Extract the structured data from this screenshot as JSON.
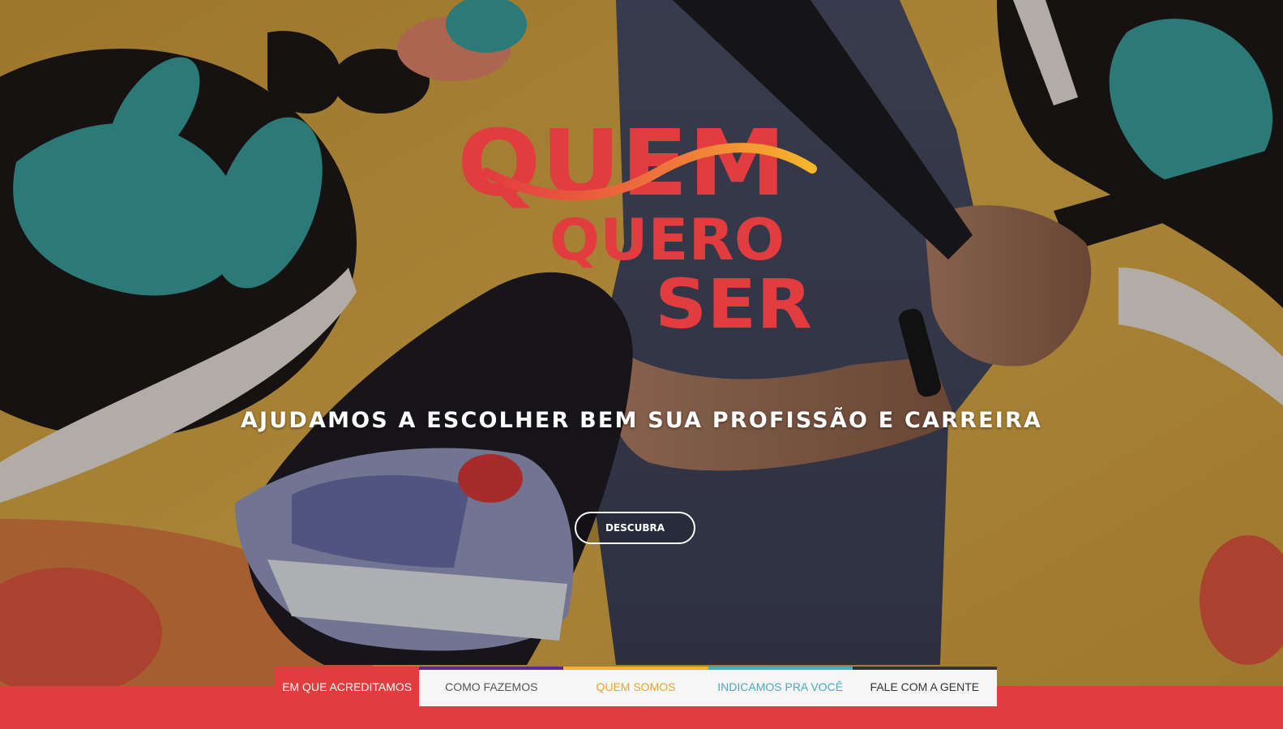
{
  "colors": {
    "brand_red": "#e23c3f",
    "gold": "#f0a22b",
    "teal": "#4aa8c4",
    "dark": "#333333",
    "purple": "#5b2d86"
  },
  "logo": {
    "line1": "QUEM",
    "line2": "QUERO",
    "line3": "SER"
  },
  "hero": {
    "tagline": "AJUDAMOS A ESCOLHER BEM SUA PROFISSÃO E CARREIRA",
    "cta_label": "DESCUBRA"
  },
  "nav": {
    "items": [
      {
        "label": "EM QUE ACREDITAMOS",
        "color": "#ffffff",
        "bar": "#e23c3f"
      },
      {
        "label": "COMO FAZEMOS",
        "color": "#555555",
        "bar": "#5b2d86"
      },
      {
        "label": "QUEM SOMOS",
        "color": "#f0a22b",
        "bar": "#f0b428"
      },
      {
        "label": "INDICAMOS PRA VOCÊ",
        "color": "#4aa8c4",
        "bar": "#4aa8c4"
      },
      {
        "label": "FALE COM A GENTE",
        "color": "#333333",
        "bar": "#333333"
      }
    ]
  }
}
